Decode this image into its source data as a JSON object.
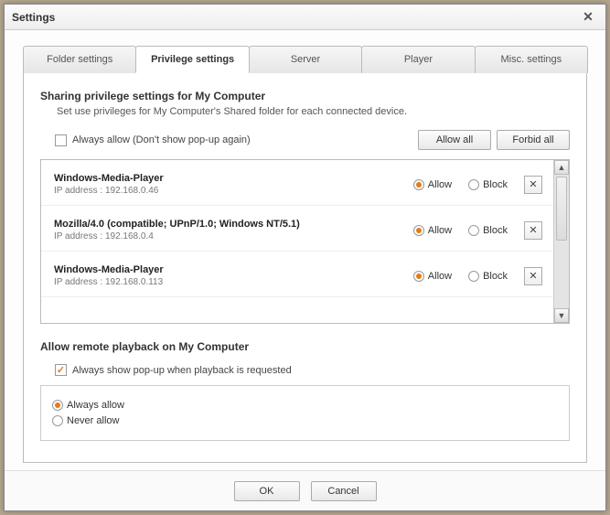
{
  "window": {
    "title": "Settings"
  },
  "tabs": [
    {
      "label": "Folder settings"
    },
    {
      "label": "Privilege settings"
    },
    {
      "label": "Server"
    },
    {
      "label": "Player"
    },
    {
      "label": "Misc. settings"
    }
  ],
  "sharing": {
    "title": "Sharing privilege settings for My Computer",
    "desc": "Set use privileges for My Computer's Shared folder for each connected device.",
    "always_allow_label": "Always allow (Don't show pop-up again)",
    "allow_all_btn": "Allow all",
    "forbid_all_btn": "Forbid all"
  },
  "option_labels": {
    "allow": "Allow",
    "block": "Block"
  },
  "devices": [
    {
      "name": "Windows-Media-Player",
      "ip": "IP address : 192.168.0.46",
      "state": "allow"
    },
    {
      "name": "Mozilla/4.0 (compatible; UPnP/1.0; Windows NT/5.1)",
      "ip": "IP address : 192.168.0.4",
      "state": "allow"
    },
    {
      "name": "Windows-Media-Player",
      "ip": "IP address : 192.168.0.113",
      "state": "allow"
    }
  ],
  "remote": {
    "title": "Allow remote playback on My Computer",
    "popup_label": "Always show pop-up when playback is requested",
    "always_label": "Always allow",
    "never_label": "Never allow"
  },
  "footer": {
    "ok": "OK",
    "cancel": "Cancel"
  }
}
